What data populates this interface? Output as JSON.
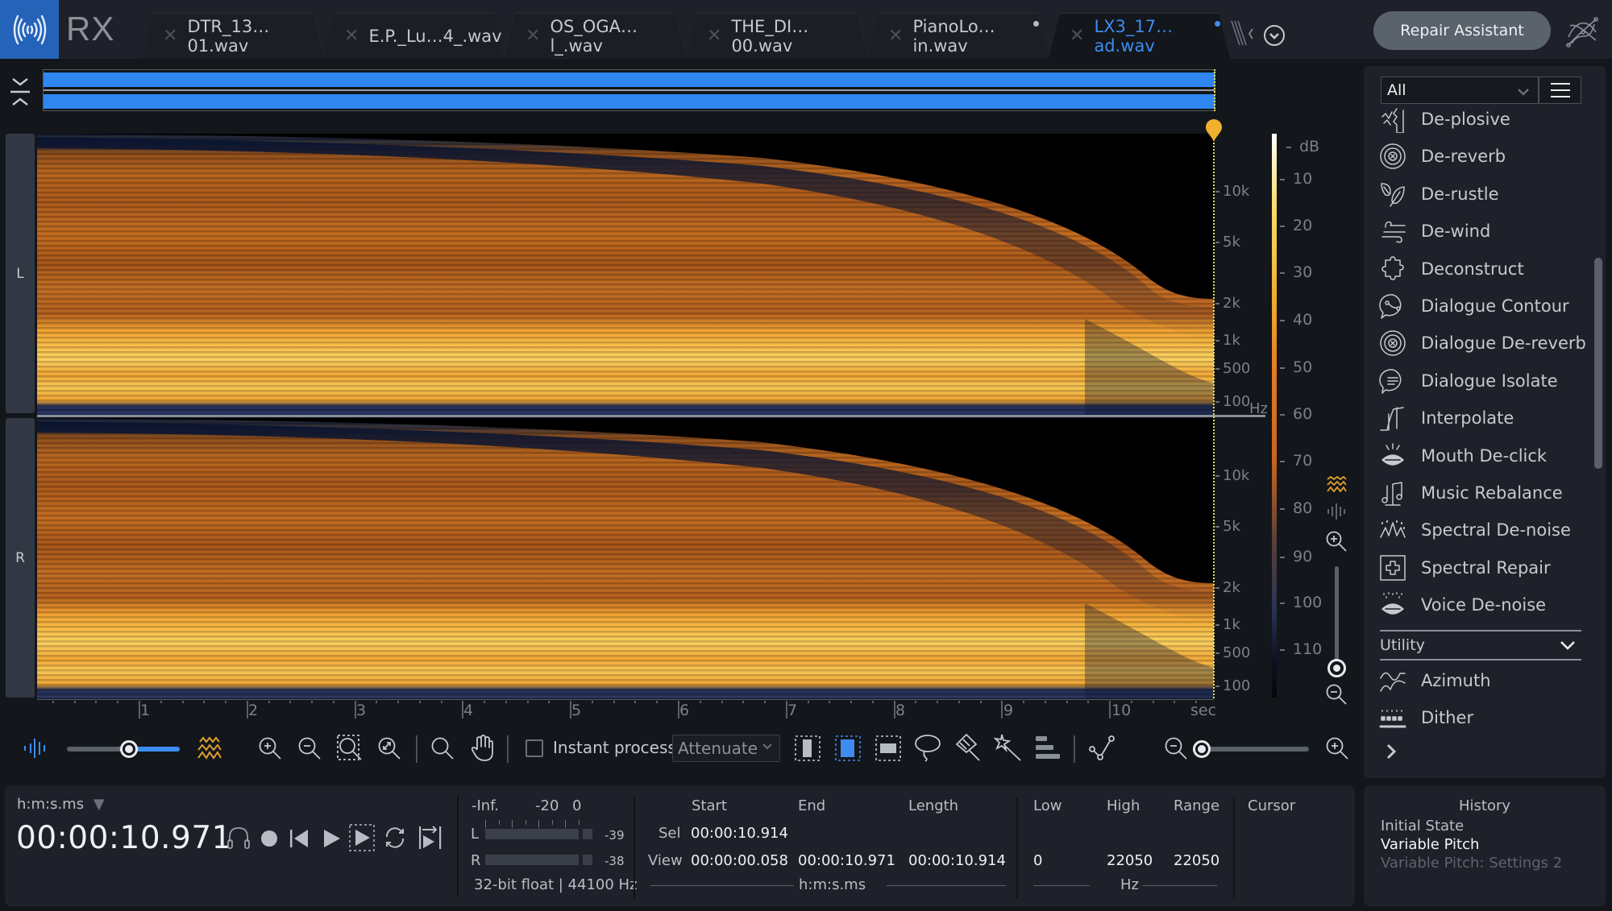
{
  "app": {
    "name": "RX"
  },
  "tabs": [
    {
      "label": "DTR_13…01.wav",
      "active": false,
      "modified": false
    },
    {
      "label": "E.P._Lu…4_.wav",
      "active": false,
      "modified": false
    },
    {
      "label": "OS_OGA…l_.wav",
      "active": false,
      "modified": false
    },
    {
      "label": "THE_DI…00.wav",
      "active": false,
      "modified": false
    },
    {
      "label": "PianoLo…in.wav",
      "active": false,
      "modified": true
    },
    {
      "label": "LX3_17…ad.wav",
      "active": true,
      "modified": true
    }
  ],
  "header": {
    "repair_assistant": "Repair Assistant"
  },
  "spectrogram": {
    "channels": [
      "L",
      "R"
    ],
    "freq_ticks": [
      "10k",
      "5k",
      "2k",
      "1k",
      "500",
      "100"
    ],
    "freq_unit": "Hz",
    "db_unit": "dB",
    "db_ticks": [
      "10",
      "20",
      "30",
      "40",
      "50",
      "60",
      "70",
      "80",
      "90",
      "100",
      "110"
    ],
    "time_ticks": [
      "1",
      "2",
      "3",
      "4",
      "5",
      "6",
      "7",
      "8",
      "9",
      "10"
    ],
    "time_unit": "sec"
  },
  "toolbar": {
    "instant_process_label": "Instant process",
    "instant_process_checked": false,
    "mode_select": "Attenuate",
    "opacity_slider": 0.55,
    "zoom_slider": 0.0
  },
  "modules": {
    "filter": "All",
    "items": [
      {
        "label": "De-plosive",
        "icon": "de-plosive-icon"
      },
      {
        "label": "De-reverb",
        "icon": "de-reverb-icon"
      },
      {
        "label": "De-rustle",
        "icon": "leaf-icon"
      },
      {
        "label": "De-wind",
        "icon": "wind-icon"
      },
      {
        "label": "Deconstruct",
        "icon": "puzzle-icon"
      },
      {
        "label": "Dialogue Contour",
        "icon": "dialogue-contour-icon"
      },
      {
        "label": "Dialogue De-reverb",
        "icon": "dialogue-de-reverb-icon"
      },
      {
        "label": "Dialogue Isolate",
        "icon": "speech-bubble-icon"
      },
      {
        "label": "Interpolate",
        "icon": "interpolate-icon"
      },
      {
        "label": "Mouth De-click",
        "icon": "mouth-click-icon"
      },
      {
        "label": "Music Rebalance",
        "icon": "music-note-icon"
      },
      {
        "label": "Spectral De-noise",
        "icon": "spectral-denoise-icon"
      },
      {
        "label": "Spectral Repair",
        "icon": "spectral-repair-icon"
      },
      {
        "label": "Voice De-noise",
        "icon": "voice-denoise-icon"
      }
    ],
    "utility_header": "Utility",
    "utility_items": [
      {
        "label": "Azimuth",
        "icon": "azimuth-icon"
      },
      {
        "label": "Dither",
        "icon": "dither-icon"
      }
    ]
  },
  "transport": {
    "time_format": "h:m:s.ms",
    "time": "00:00:10.971"
  },
  "meter": {
    "scale": [
      "-Inf.",
      "-20",
      "0"
    ],
    "left_label": "L",
    "right_label": "R",
    "left_value": "-39",
    "right_value": "-38",
    "format": "32-bit float | 44100 Hz"
  },
  "selection": {
    "headers": [
      "Start",
      "End",
      "Length"
    ],
    "rows": [
      {
        "label": "Sel",
        "start": "00:00:10.914",
        "end": "",
        "length": ""
      },
      {
        "label": "View",
        "start": "00:00:00.058",
        "end": "00:00:10.971",
        "length": "00:00:10.914"
      }
    ],
    "unit": "h:m:s.ms"
  },
  "frequency": {
    "headers": [
      "Low",
      "High",
      "Range"
    ],
    "values": [
      "0",
      "22050",
      "22050"
    ],
    "unit": "Hz"
  },
  "cursor": {
    "label": "Cursor"
  },
  "history": {
    "title": "History",
    "items": [
      {
        "label": "Initial State",
        "state": "past"
      },
      {
        "label": "Variable Pitch",
        "state": "current"
      },
      {
        "label": "Variable Pitch: Settings 2",
        "state": "undone"
      }
    ]
  }
}
